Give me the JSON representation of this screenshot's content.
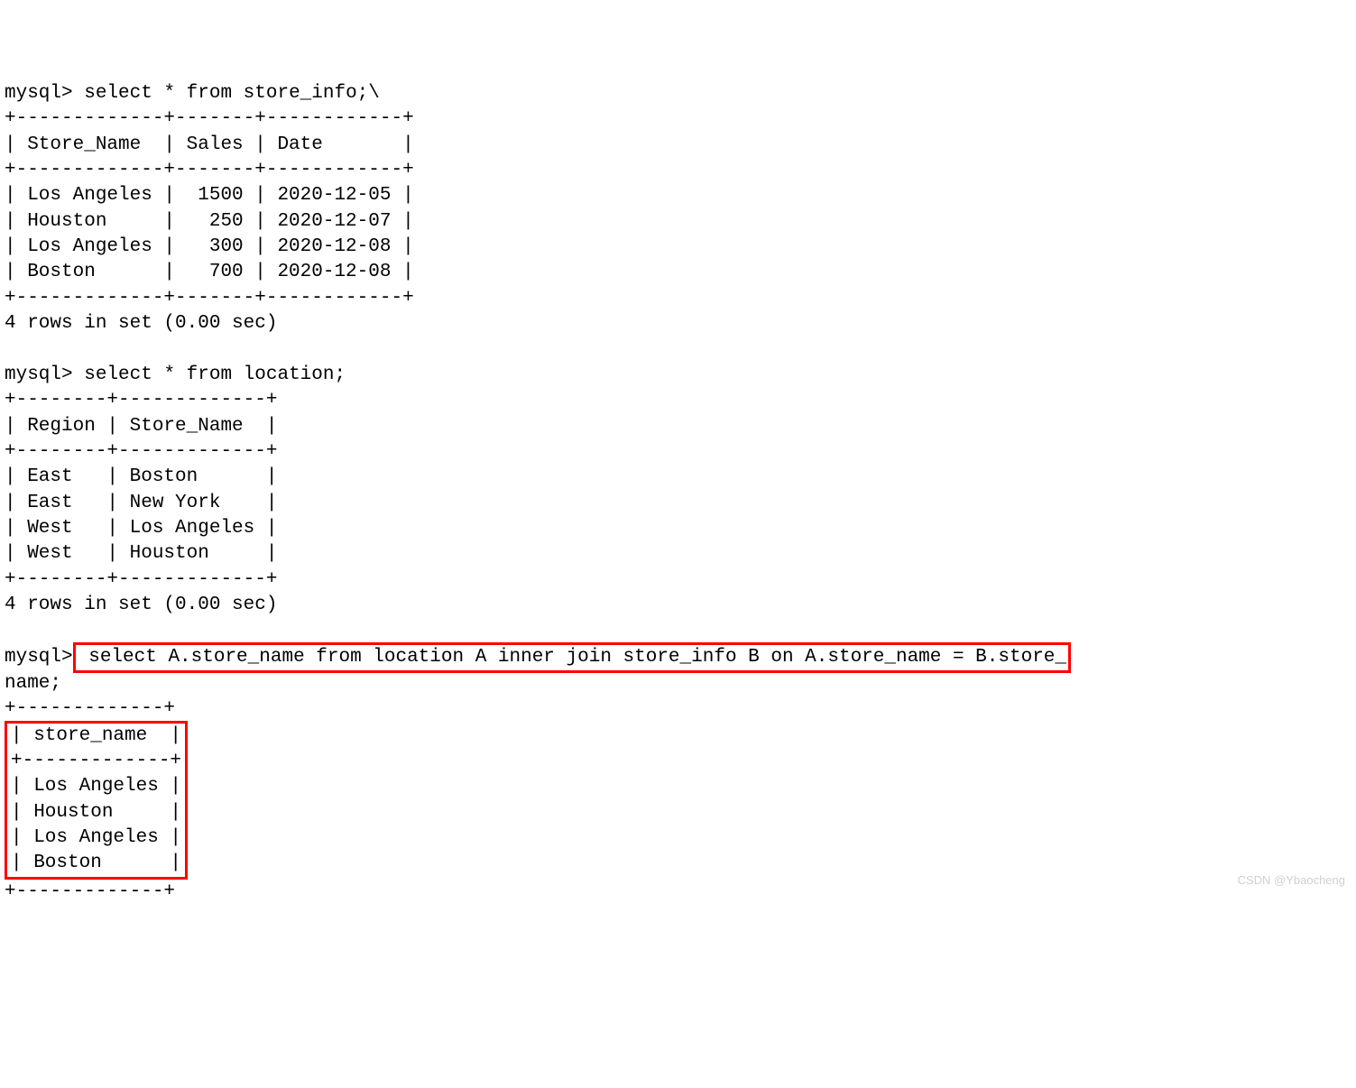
{
  "query1": {
    "prompt": "mysql>",
    "sql": "select * from store_info;\\",
    "sep_top": "+-------------+-------+------------+",
    "header": "| Store_Name  | Sales | Date       |",
    "sep_mid": "+-------------+-------+------------+",
    "row1": "| Los Angeles |  1500 | 2020-12-05 |",
    "row2": "| Houston     |   250 | 2020-12-07 |",
    "row3": "| Los Angeles |   300 | 2020-12-08 |",
    "row4": "| Boston      |   700 | 2020-12-08 |",
    "sep_bot": "+-------------+-------+------------+",
    "footer": "4 rows in set (0.00 sec)"
  },
  "query2": {
    "prompt": "mysql>",
    "sql": "select * from location;",
    "sep_top": "+--------+-------------+",
    "header": "| Region | Store_Name  |",
    "sep_mid": "+--------+-------------+",
    "row1": "| East   | Boston      |",
    "row2": "| East   | New York    |",
    "row3": "| West   | Los Angeles |",
    "row4": "| West   | Houston     |",
    "sep_bot": "+--------+-------------+",
    "footer": "4 rows in set (0.00 sec)"
  },
  "query3": {
    "prompt": "mysql>",
    "sql_line1": " select A.store_name from location A inner join store_info B on A.store_name = B.store_",
    "sql_line2": "name;",
    "sep_top": "+-------------+",
    "header": "| store_name  |",
    "sep_mid": "+-------------+",
    "row1": "| Los Angeles |",
    "row2": "| Houston     |",
    "row3": "| Los Angeles |",
    "row4": "| Boston      |",
    "sep_bot": "+-------------+"
  },
  "watermark": "CSDN @Ybaocheng"
}
